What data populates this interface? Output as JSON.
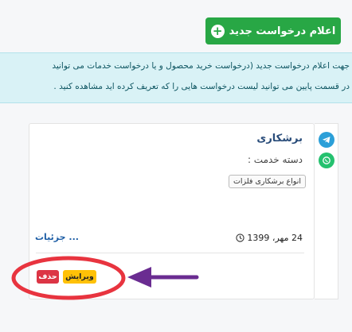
{
  "toolbar": {
    "new_request_label": "اعلام درخواست جدید"
  },
  "info": {
    "lines": [
      "جهت اعلام درخواست جدید (درخواست خرید محصول و یا درخواست خدمات می توانید",
      "در قسمت پایین می توانید لیست درخواست هایی را که تعریف کرده اید مشاهده کنید ."
    ]
  },
  "card": {
    "title": "برشکاری",
    "category_label": "دسته خدمت :",
    "tag": "انواع برشکاری فلزات",
    "date": "24 مهر، 1399",
    "details_link": "جزئیات ...",
    "edit_label": "ویرایش",
    "delete_label": "حذف"
  },
  "colors": {
    "brand_green": "#28a745",
    "info_bg": "#d9f2f6",
    "title_blue": "#2a4d7a",
    "delete_red": "#dc3545",
    "edit_yellow": "#ffc107",
    "highlight_ellipse": "#e8343f",
    "arrow_purple": "#6a2c91"
  },
  "icons": {
    "telegram": "telegram-icon",
    "whatsapp": "whatsapp-icon",
    "clock": "clock-icon",
    "plus": "plus-icon"
  }
}
